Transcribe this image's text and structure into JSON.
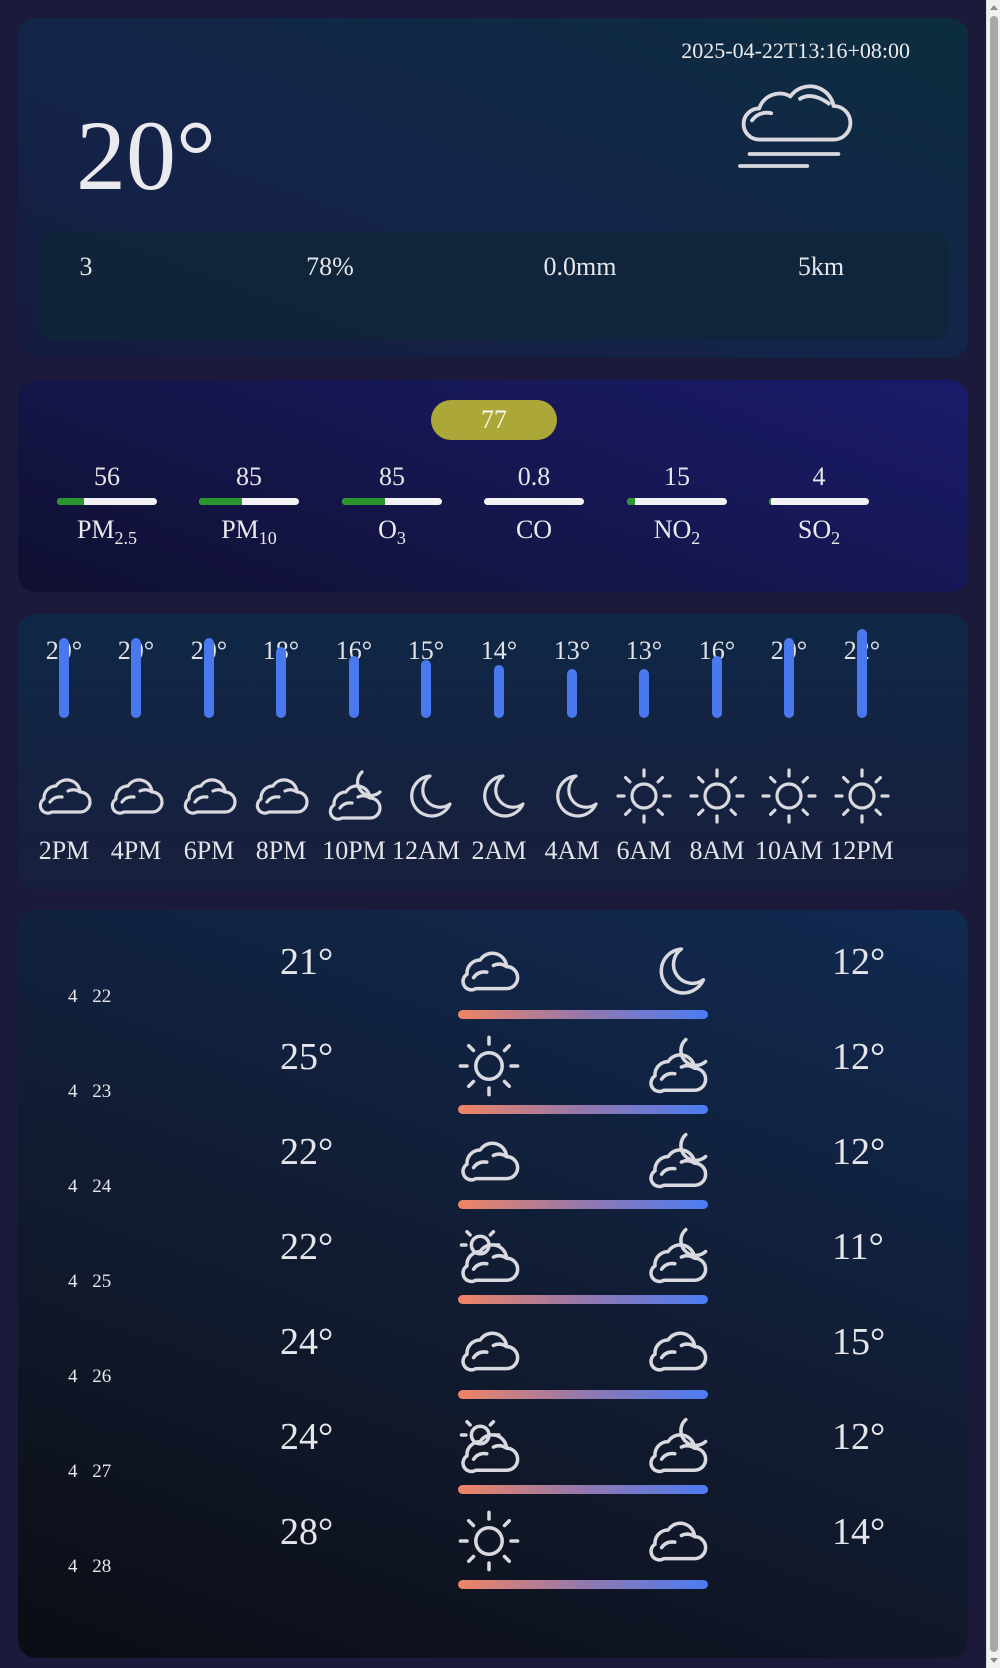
{
  "current": {
    "timestamp": "2025-04-22T13:16+08:00",
    "temperature": "20°",
    "icon": "cloud-fog-icon",
    "stats": [
      "3",
      "78%",
      "0.0mm",
      "5km"
    ]
  },
  "air_quality": {
    "index": "77",
    "index_color": "#aca739",
    "pollutants": [
      {
        "value": "56",
        "name": "PM",
        "sub": "2.5",
        "level": 0.27
      },
      {
        "value": "85",
        "name": "PM",
        "sub": "10",
        "level": 0.43
      },
      {
        "value": "85",
        "name": "O",
        "sub": "3",
        "level": 0.43
      },
      {
        "value": "0.8",
        "name": "CO",
        "sub": "",
        "level": 0.0
      },
      {
        "value": "15",
        "name": "NO",
        "sub": "2",
        "level": 0.08
      },
      {
        "value": "4",
        "name": "SO",
        "sub": "2",
        "level": 0.02
      }
    ]
  },
  "hourly": [
    {
      "time": "2PM",
      "temp": "20°",
      "value": 20,
      "icon": "cloud-icon"
    },
    {
      "time": "4PM",
      "temp": "20°",
      "value": 20,
      "icon": "cloud-icon"
    },
    {
      "time": "6PM",
      "temp": "20°",
      "value": 20,
      "icon": "cloud-icon"
    },
    {
      "time": "8PM",
      "temp": "18°",
      "value": 18,
      "icon": "cloud-icon"
    },
    {
      "time": "10PM",
      "temp": "16°",
      "value": 16,
      "icon": "cloud-moon-icon"
    },
    {
      "time": "12AM",
      "temp": "15°",
      "value": 15,
      "icon": "moon-icon"
    },
    {
      "time": "2AM",
      "temp": "14°",
      "value": 14,
      "icon": "moon-icon"
    },
    {
      "time": "4AM",
      "temp": "13°",
      "value": 13,
      "icon": "moon-icon"
    },
    {
      "time": "6AM",
      "temp": "13°",
      "value": 13,
      "icon": "sun-icon"
    },
    {
      "time": "8AM",
      "temp": "16°",
      "value": 16,
      "icon": "sun-icon"
    },
    {
      "time": "10AM",
      "temp": "20°",
      "value": 20,
      "icon": "sun-icon"
    },
    {
      "time": "12PM",
      "temp": "22°",
      "value": 22,
      "icon": "sun-icon"
    }
  ],
  "daily": [
    {
      "date": "4 22",
      "high": "21°",
      "low": "12°",
      "day_icon": "cloud-icon",
      "night_icon": "moon-icon"
    },
    {
      "date": "4 23",
      "high": "25°",
      "low": "12°",
      "day_icon": "sun-icon",
      "night_icon": "cloud-moon-icon"
    },
    {
      "date": "4 24",
      "high": "22°",
      "low": "12°",
      "day_icon": "cloud-icon",
      "night_icon": "cloud-moon-icon"
    },
    {
      "date": "4 25",
      "high": "22°",
      "low": "11°",
      "day_icon": "cloud-sun-icon",
      "night_icon": "cloud-moon-icon"
    },
    {
      "date": "4 26",
      "high": "24°",
      "low": "15°",
      "day_icon": "cloud-icon",
      "night_icon": "cloud-icon"
    },
    {
      "date": "4 27",
      "high": "24°",
      "low": "12°",
      "day_icon": "cloud-sun-icon",
      "night_icon": "cloud-moon-icon"
    },
    {
      "date": "4 28",
      "high": "28°",
      "low": "14°",
      "day_icon": "sun-icon",
      "night_icon": "cloud-icon"
    }
  ]
}
